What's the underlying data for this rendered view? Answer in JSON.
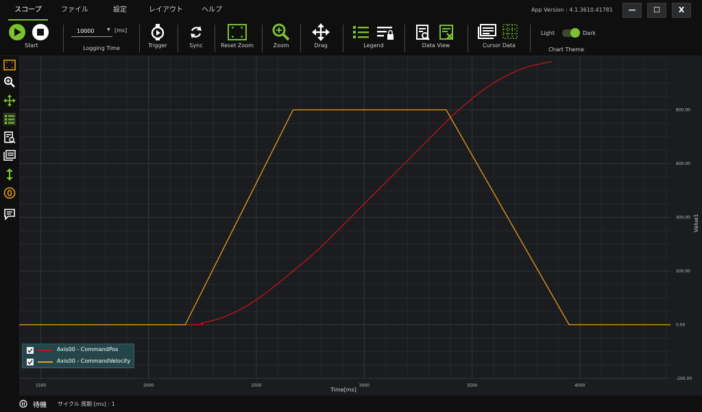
{
  "menu": {
    "items": [
      {
        "label": "スコープ"
      },
      {
        "label": "ファイル"
      },
      {
        "label": "設定"
      },
      {
        "label": "レイアウト"
      },
      {
        "label": "ヘルプ"
      }
    ],
    "active": "スコープ"
  },
  "app_version": "App Version : 4.1.3610.41781",
  "window_controls": {
    "minimize": "—",
    "maximize": "☐",
    "close": "X"
  },
  "toolbar": {
    "start_label": "Start",
    "logging_time_value": "10000",
    "logging_time_unit": "[ms]",
    "logging_time_label": "Logging Time",
    "trigger_label": "Trigger",
    "sync_label": "Sync",
    "reset_zoom_label": "Reset Zoom",
    "zoom_label": "Zoom",
    "drag_label": "Drag",
    "legend_label": "Legend",
    "data_view_label": "Data View",
    "cursor_data_label": "Cursor Data",
    "theme_light": "Light",
    "theme_dark": "Dark",
    "chart_theme_label": "Chart Theme",
    "theme_selected": "Dark"
  },
  "sidebar": {
    "icons": [
      "reset-zoom-icon",
      "zoom-icon",
      "drag-icon",
      "legend-icon",
      "data-view-icon",
      "cursor-data-icon",
      "vertical-resize-icon",
      "zero-icon",
      "comment-icon"
    ]
  },
  "colors": {
    "accent": "#7cc230",
    "background": "#1b1c1f",
    "series_pos": "#c0151b",
    "series_vel": "#e6a019"
  },
  "chart_data": {
    "type": "line",
    "xlabel": "Time[ms]",
    "ylabel": "Value1",
    "xlim": [
      1400,
      4420
    ],
    "ylim": [
      -200,
      1000
    ],
    "x_ticks": [
      1500,
      2000,
      2500,
      3000,
      3500,
      4000
    ],
    "y_ticks": [
      -200,
      0,
      200,
      400,
      600,
      800
    ],
    "y_tick_labels": [
      "-200.00",
      "0.00",
      "200.00",
      "400.00",
      "600.00",
      "800.00"
    ],
    "grid": true,
    "legend_position": "bottom-left",
    "series": [
      {
        "name": "Axis00 - CommandPos",
        "color": "#c0151b",
        "x": [
          1400,
          2170,
          2250,
          2350,
          2450,
          2550,
          2670,
          2800,
          3000,
          3200,
          3380,
          3450,
          3550,
          3650,
          3750,
          3870
        ],
        "y": [
          0,
          0,
          7,
          29,
          68,
          122,
          200,
          290,
          450,
          610,
          756,
          808,
          873,
          923,
          958,
          980
        ]
      },
      {
        "name": "Axis00 - CommandVelocity",
        "color": "#e6a019",
        "x": [
          1400,
          2170,
          2670,
          3380,
          3950,
          4420
        ],
        "y": [
          0,
          0,
          800,
          800,
          0,
          0
        ]
      }
    ]
  },
  "legend": {
    "items": [
      {
        "label": "Axis00 - CommandPos",
        "checked": true,
        "color": "#c0151b"
      },
      {
        "label": "Axis00 - CommandVelocity",
        "checked": true,
        "color": "#e6a019"
      }
    ]
  },
  "status": {
    "state": "待機",
    "cycle_label": "サイクル 周期 [ms] : 1"
  }
}
